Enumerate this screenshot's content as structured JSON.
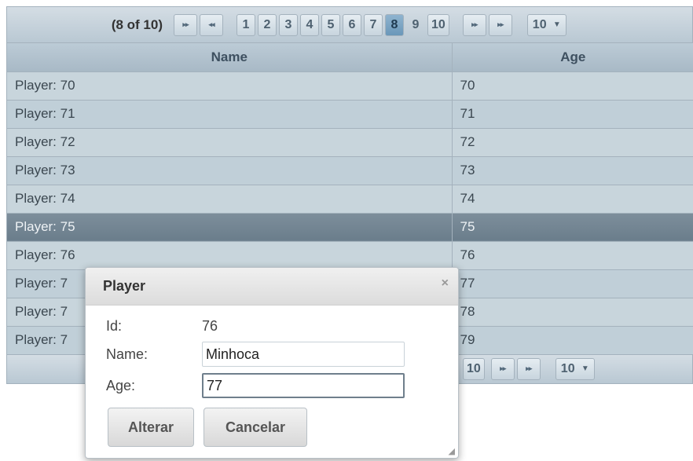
{
  "paginator": {
    "current_report": "(8 of 10)",
    "first_icon": "first-page-icon",
    "prev_icon": "prev-page-icon",
    "next_icon": "next-page-icon",
    "last_icon": "last-page-icon",
    "pages": [
      "1",
      "2",
      "3",
      "4",
      "5",
      "6",
      "7",
      "8",
      "9",
      "10"
    ],
    "active_page": "8",
    "rows_per_page": "10"
  },
  "table": {
    "columns": [
      "Name",
      "Age"
    ],
    "rows": [
      {
        "name": "Player: 70",
        "age": "70"
      },
      {
        "name": "Player: 71",
        "age": "71"
      },
      {
        "name": "Player: 72",
        "age": "72"
      },
      {
        "name": "Player: 73",
        "age": "73"
      },
      {
        "name": "Player: 74",
        "age": "74"
      },
      {
        "name": "Player: 75",
        "age": "75"
      },
      {
        "name": "Player: 76",
        "age": "76"
      },
      {
        "name": "Player: 7",
        "age": "77"
      },
      {
        "name": "Player: 7",
        "age": "78"
      },
      {
        "name": "Player: 7",
        "age": "79"
      }
    ],
    "selected_row_index": 5
  },
  "bottom_paginator": {
    "page_visible": "10",
    "rows_per_page": "10"
  },
  "dialog": {
    "title": "Player",
    "id_label": "Id:",
    "id_value": "76",
    "name_label": "Name:",
    "name_value": "Minhoca",
    "age_label": "Age:",
    "age_value": "77",
    "save_label": "Alterar",
    "cancel_label": "Cancelar",
    "close_glyph": "×"
  },
  "colors": {
    "selected_row": "#6f808d",
    "active_page": "#7fa8c6",
    "header_bg": "#b3c3cf"
  }
}
